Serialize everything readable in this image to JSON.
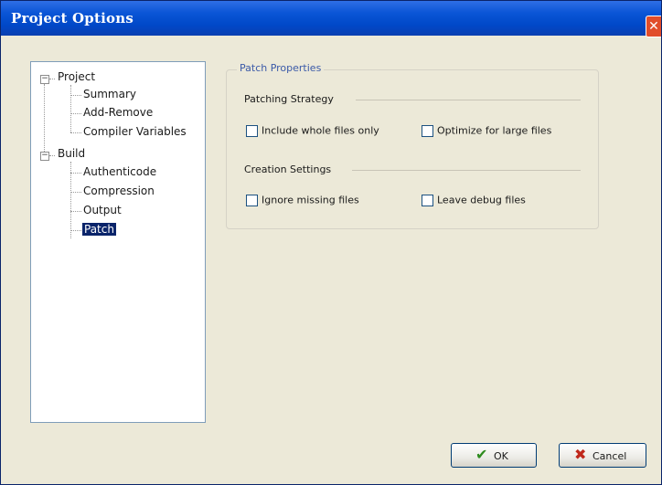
{
  "window": {
    "title": "Project Options",
    "close_icon": "close-icon"
  },
  "tree": {
    "project_label": "Project",
    "project_items": [
      "Summary",
      "Add-Remove",
      "Compiler Variables"
    ],
    "build_label": "Build",
    "build_items": [
      "Authenticode",
      "Compression",
      "Output",
      "Patch"
    ],
    "selected": "Patch",
    "expander_glyph": "⊟"
  },
  "patch_properties": {
    "group_title": "Patch Properties",
    "patching_strategy": {
      "label": "Patching Strategy",
      "include_whole_files": {
        "label": "Include whole files only",
        "checked": false
      },
      "optimize_large_files": {
        "label": "Optimize for large files",
        "checked": false
      }
    },
    "creation_settings": {
      "label": "Creation Settings",
      "ignore_missing_files": {
        "label": "Ignore missing files",
        "checked": false
      },
      "leave_debug_files": {
        "label": "Leave debug files",
        "checked": false
      }
    }
  },
  "buttons": {
    "ok": {
      "label": "OK",
      "icon": "checkmark-icon",
      "glyph": "✔",
      "color": "#2e8b1e"
    },
    "cancel": {
      "label": "Cancel",
      "icon": "x-icon",
      "glyph": "✖",
      "color": "#c0281c"
    }
  }
}
